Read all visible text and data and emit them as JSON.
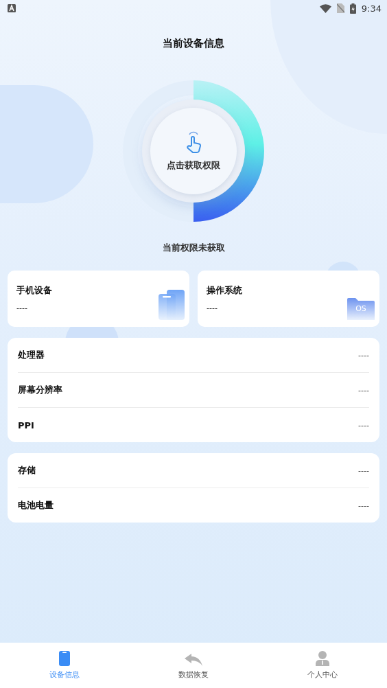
{
  "status_bar": {
    "time": "9:34"
  },
  "title": "当前设备信息",
  "permission": {
    "button": "点击获取权限",
    "status": "当前权限未获取"
  },
  "summary_cards": [
    {
      "kind": "phone",
      "label": "手机设备",
      "value": "----"
    },
    {
      "kind": "os",
      "label": "操作系统",
      "value": "----",
      "icon_text": "OS"
    }
  ],
  "groups": [
    [
      {
        "label": "处理器",
        "value": "----"
      },
      {
        "label": "屏幕分辨率",
        "value": "----"
      },
      {
        "label": "PPI",
        "value": "----"
      }
    ],
    [
      {
        "label": "存储",
        "value": "----"
      },
      {
        "label": "电池电量",
        "value": "----"
      }
    ]
  ],
  "nav": [
    {
      "kind": "device",
      "label": "设备信息",
      "selected": true
    },
    {
      "kind": "restore",
      "label": "数据恢复",
      "selected": false
    },
    {
      "kind": "person",
      "label": "个人中心",
      "selected": false
    }
  ]
}
